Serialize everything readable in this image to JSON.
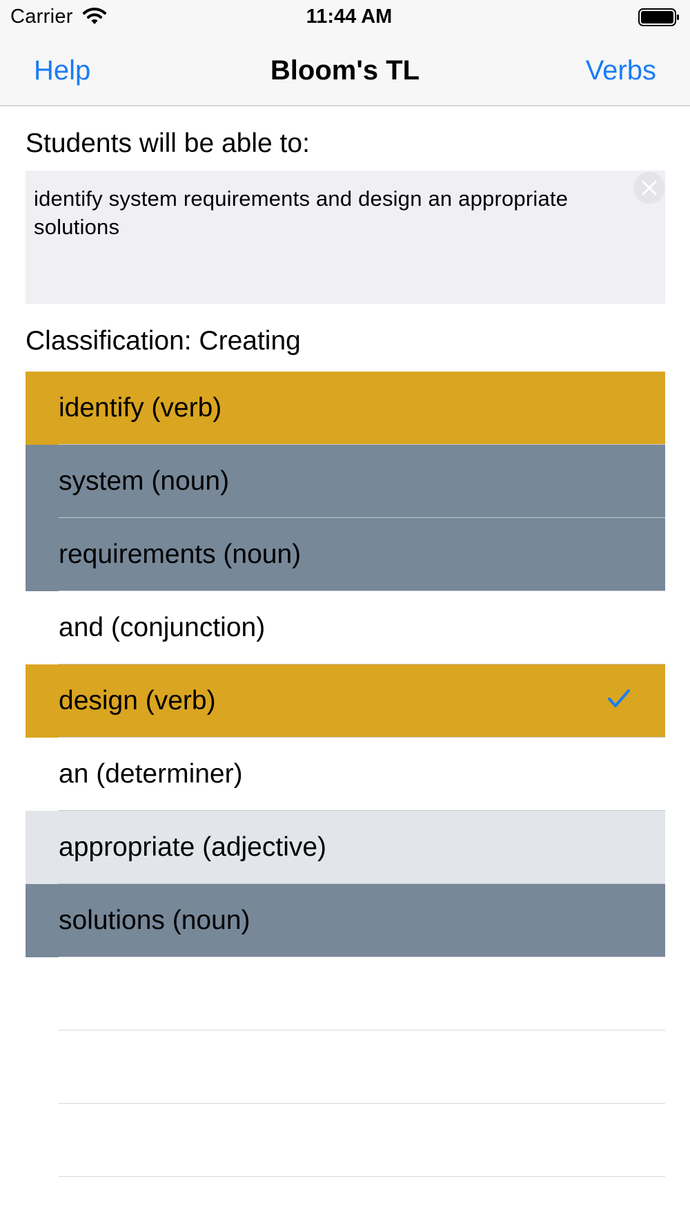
{
  "status_bar": {
    "carrier": "Carrier",
    "time": "11:44 AM"
  },
  "nav": {
    "left_button": "Help",
    "title": "Bloom's TL",
    "right_button": "Verbs"
  },
  "prompt_label": "Students will be able to:",
  "objective_text": "identify system requirements and design an appropriate solutions",
  "classification": "Classification: Creating",
  "colors": {
    "verb": "#daa520",
    "noun": "#778899",
    "adjective": "#e2e5e9",
    "other": "#ffffff",
    "accent": "#1a7cf5"
  },
  "tokens": [
    {
      "label": "identify (verb)",
      "type": "verb",
      "checked": false
    },
    {
      "label": "system (noun)",
      "type": "noun",
      "checked": false
    },
    {
      "label": "requirements (noun)",
      "type": "noun",
      "checked": false
    },
    {
      "label": "and (conjunction)",
      "type": "other",
      "checked": false
    },
    {
      "label": "design (verb)",
      "type": "verb",
      "checked": true
    },
    {
      "label": "an (determiner)",
      "type": "other",
      "checked": false
    },
    {
      "label": "appropriate (adjective)",
      "type": "adjective",
      "checked": false
    },
    {
      "label": "solutions (noun)",
      "type": "noun",
      "checked": false
    }
  ]
}
